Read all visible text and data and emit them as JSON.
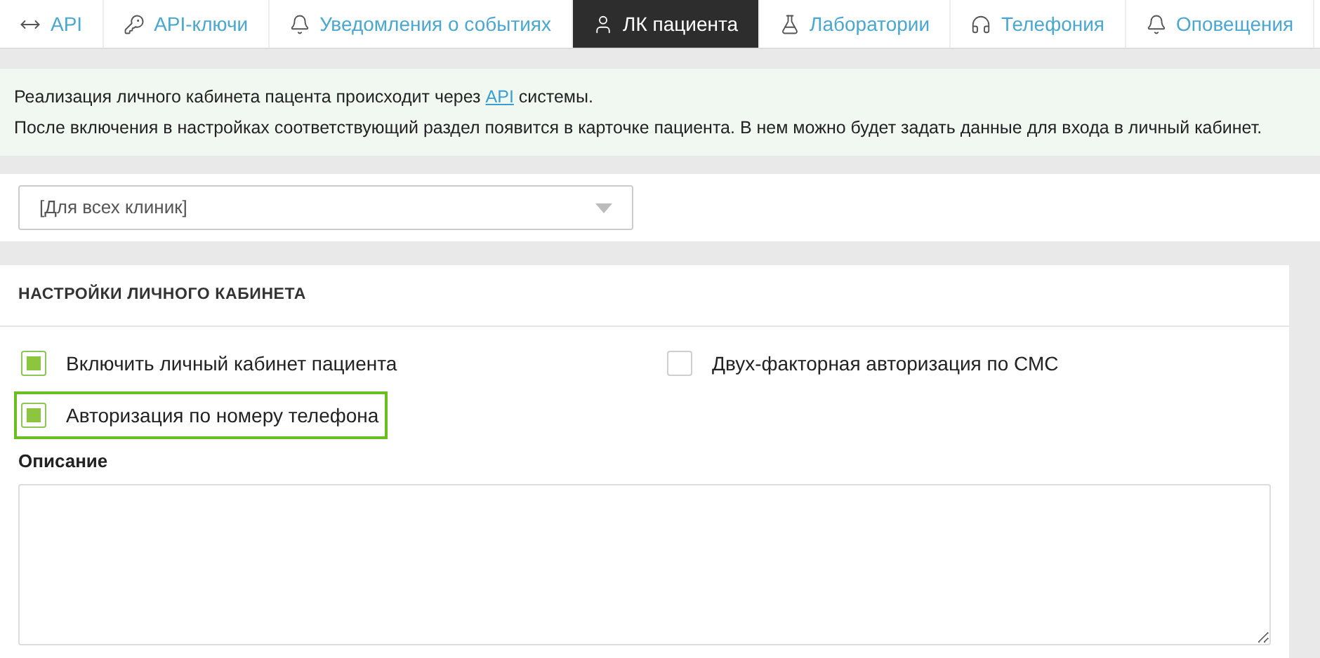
{
  "tabs": [
    {
      "kind": "arrows",
      "label": "API",
      "selected": false
    },
    {
      "kind": "key",
      "label": "API-ключи",
      "selected": false
    },
    {
      "kind": "bell",
      "label": "Уведомления о событиях",
      "selected": false
    },
    {
      "kind": "user",
      "label": "ЛК пациента",
      "selected": true
    },
    {
      "kind": "flask",
      "label": "Лаборатории",
      "selected": false
    },
    {
      "kind": "headphones",
      "label": "Телефония",
      "selected": false
    },
    {
      "kind": "bell",
      "label": "Оповещения",
      "selected": false
    }
  ],
  "info": {
    "line_1": {
      "before": "Реализация личного кабинета пацента происходит через",
      "link": "API",
      "after": "системы."
    },
    "line_2": "После включения в настройках соответствующий раздел появится в карточке пациента. В нем можно будет задать данные для входа в личный кабинет."
  },
  "clinic_select": {
    "value": "[Для всех клиник]"
  },
  "settings": {
    "title": "НАСТРОЙКИ ЛИЧНОГО КАБИНЕТА",
    "left_options": [
      {
        "label": "Включить личный кабинет пациента",
        "checked": true,
        "focused": false
      },
      {
        "label": "Авторизация по номеру телефона",
        "checked": true,
        "focused": true
      }
    ],
    "right_options": [
      {
        "label": "Двух-факторная авторизация по СМС",
        "checked": false,
        "focused": false
      }
    ],
    "description_label": "Описание"
  }
}
